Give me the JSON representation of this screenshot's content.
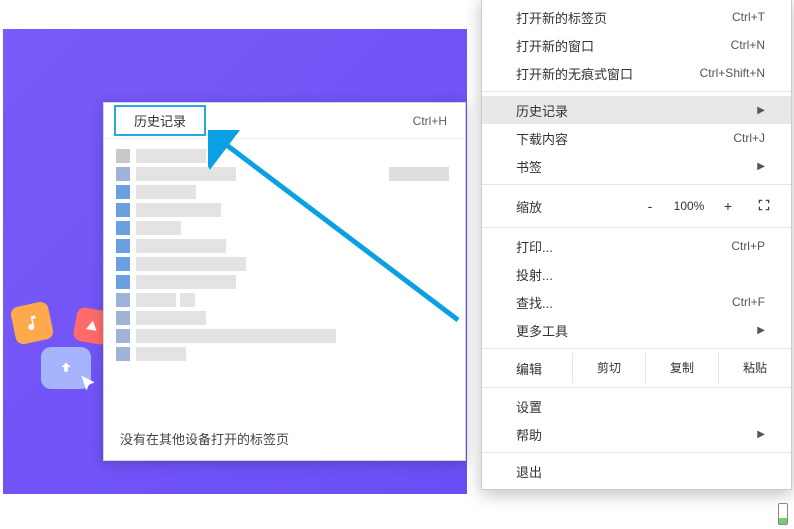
{
  "submenu": {
    "history_label": "历史记录",
    "history_shortcut": "Ctrl+H",
    "no_other_devices": "没有在其他设备打开的标签页"
  },
  "main_menu": {
    "sec1": {
      "new_tab": {
        "label": "打开新的标签页",
        "shortcut": "Ctrl+T"
      },
      "new_window": {
        "label": "打开新的窗口",
        "shortcut": "Ctrl+N"
      },
      "new_incognito": {
        "label": "打开新的无痕式窗口",
        "shortcut": "Ctrl+Shift+N"
      }
    },
    "sec2": {
      "history": {
        "label": "历史记录"
      },
      "downloads": {
        "label": "下载内容",
        "shortcut": "Ctrl+J"
      },
      "bookmarks": {
        "label": "书签"
      }
    },
    "zoom": {
      "label": "缩放",
      "minus": "-",
      "percent": "100%",
      "plus": "+"
    },
    "sec4": {
      "print": {
        "label": "打印...",
        "shortcut": "Ctrl+P"
      },
      "cast": {
        "label": "投射..."
      },
      "find": {
        "label": "查找...",
        "shortcut": "Ctrl+F"
      },
      "more_tools": {
        "label": "更多工具"
      }
    },
    "edit": {
      "label": "编辑",
      "cut": "剪切",
      "copy": "复制",
      "paste": "粘贴"
    },
    "sec6": {
      "settings": {
        "label": "设置"
      },
      "help": {
        "label": "帮助"
      }
    },
    "exit": {
      "label": "退出"
    }
  }
}
